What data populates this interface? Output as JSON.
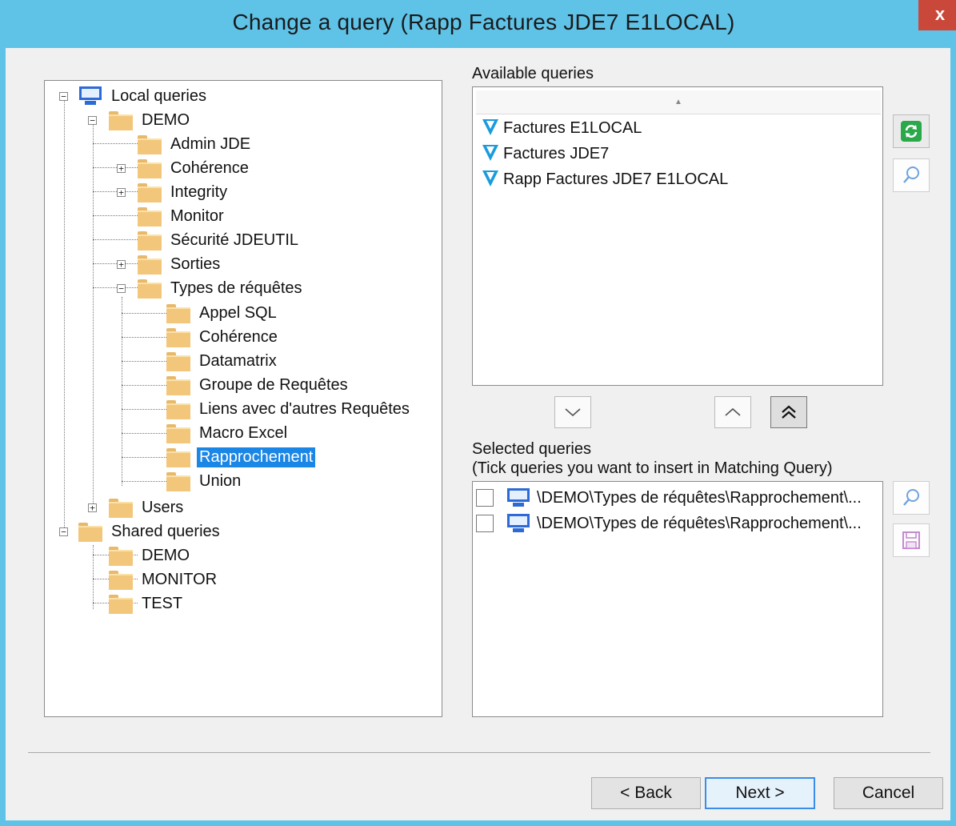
{
  "window": {
    "title": "Change a query (Rapp Factures JDE7 E1LOCAL)",
    "close_label": "x"
  },
  "tree": {
    "local_queries": "Local queries",
    "demo": "DEMO",
    "admin_jde": "Admin JDE",
    "coherence": "Cohérence",
    "integrity": "Integrity",
    "monitor": "Monitor",
    "securite": "Sécurité JDEUTIL",
    "sorties": "Sorties",
    "types": "Types de réquêtes",
    "appel_sql": "Appel SQL",
    "coherence2": "Cohérence",
    "datamatrix": "Datamatrix",
    "groupe": "Groupe de Requêtes",
    "liens": "Liens avec d'autres Requêtes",
    "macro": "Macro Excel",
    "rapprochement": "Rapprochement",
    "union": "Union",
    "users": "Users",
    "shared_queries": "Shared queries",
    "shared_demo": "DEMO",
    "shared_monitor": "MONITOR",
    "shared_test": "TEST",
    "selected_item": "Rapprochement"
  },
  "available": {
    "label": "Available queries",
    "sort_indicator": "▲",
    "items": [
      "Factures E1LOCAL",
      "Factures JDE7",
      "Rapp Factures JDE7 E1LOCAL"
    ]
  },
  "selected": {
    "label_line1": "Selected queries",
    "label_line2": "(Tick queries you want to insert in Matching Query)",
    "items": [
      {
        "path": "\\DEMO\\Types de réquêtes\\Rapprochement\\...",
        "checked": false
      },
      {
        "path": "\\DEMO\\Types de réquêtes\\Rapprochement\\...",
        "checked": false
      }
    ]
  },
  "buttons": {
    "back": "< Back",
    "next": "Next >",
    "cancel": "Cancel"
  },
  "colors": {
    "titlebar": "#5fc3e8",
    "close": "#c9483a",
    "selection": "#1a86e6",
    "folder": "#f3c77b",
    "query_icon": "#1a9bdc",
    "refresh_icon": "#2aa84a"
  },
  "icons": {
    "refresh": "refresh-icon",
    "search": "search-icon",
    "save": "save-icon",
    "move_down": "chevron-down-icon",
    "move_up": "chevron-up-icon",
    "move_top": "double-chevron-up-icon"
  }
}
